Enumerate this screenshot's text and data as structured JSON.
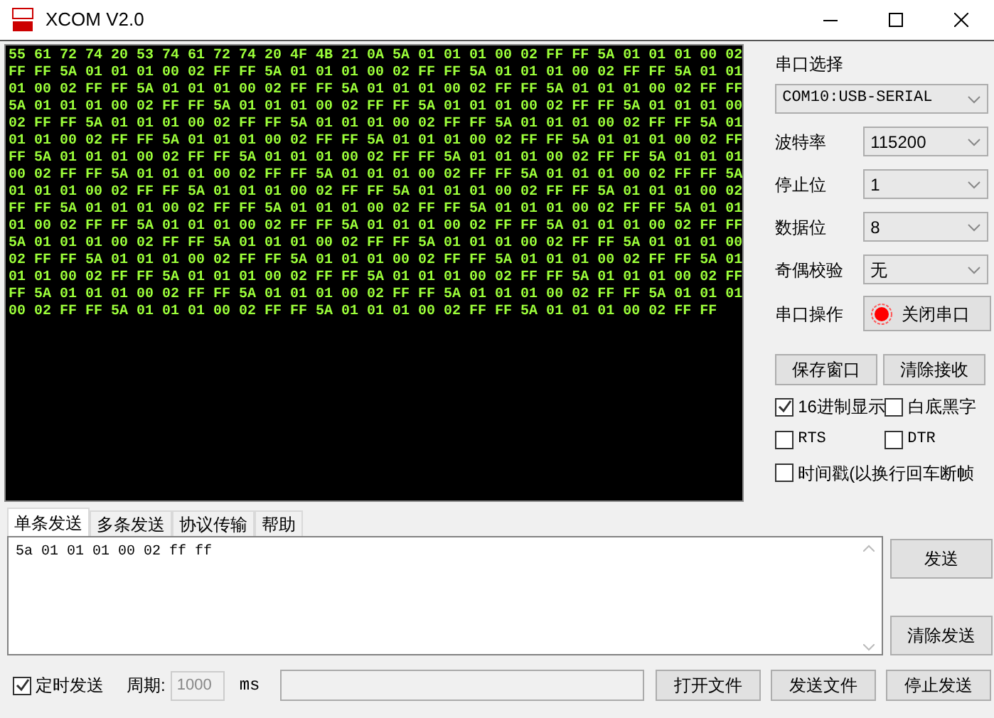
{
  "window": {
    "title": "XCOM V2.0"
  },
  "receive_lines": [
    "55 61 72 74 20 53 74 61 72 74 20 4F 4B 21 0A 5A 01 01 01 00 02 FF FF 5A 01 01 01 00 02",
    "FF FF 5A 01 01 01 00 02 FF FF 5A 01 01 01 00 02 FF FF 5A 01 01 01 00 02 FF FF 5A 01 01",
    "01 00 02 FF FF 5A 01 01 01 00 02 FF FF 5A 01 01 01 00 02 FF FF 5A 01 01 01 00 02 FF FF",
    "5A 01 01 01 00 02 FF FF 5A 01 01 01 00 02 FF FF 5A 01 01 01 00 02 FF FF 5A 01 01 01 00",
    "02 FF FF 5A 01 01 01 00 02 FF FF 5A 01 01 01 00 02 FF FF 5A 01 01 01 00 02 FF FF 5A 01",
    "01 01 00 02 FF FF 5A 01 01 01 00 02 FF FF 5A 01 01 01 00 02 FF FF 5A 01 01 01 00 02 FF",
    "FF 5A 01 01 01 00 02 FF FF 5A 01 01 01 00 02 FF FF 5A 01 01 01 00 02 FF FF 5A 01 01 01",
    "00 02 FF FF 5A 01 01 01 00 02 FF FF 5A 01 01 01 00 02 FF FF 5A 01 01 01 00 02 FF FF 5A",
    "01 01 01 00 02 FF FF 5A 01 01 01 00 02 FF FF 5A 01 01 01 00 02 FF FF 5A 01 01 01 00 02",
    "FF FF 5A 01 01 01 00 02 FF FF 5A 01 01 01 00 02 FF FF 5A 01 01 01 00 02 FF FF 5A 01 01",
    "01 00 02 FF FF 5A 01 01 01 00 02 FF FF 5A 01 01 01 00 02 FF FF 5A 01 01 01 00 02 FF FF",
    "5A 01 01 01 00 02 FF FF 5A 01 01 01 00 02 FF FF 5A 01 01 01 00 02 FF FF 5A 01 01 01 00",
    "02 FF FF 5A 01 01 01 00 02 FF FF 5A 01 01 01 00 02 FF FF 5A 01 01 01 00 02 FF FF 5A 01",
    "01 01 00 02 FF FF 5A 01 01 01 00 02 FF FF 5A 01 01 01 00 02 FF FF 5A 01 01 01 00 02 FF",
    "FF 5A 01 01 01 00 02 FF FF 5A 01 01 01 00 02 FF FF 5A 01 01 01 00 02 FF FF 5A 01 01 01",
    "00 02 FF FF 5A 01 01 01 00 02 FF FF 5A 01 01 01 00 02 FF FF 5A 01 01 01 00 02 FF FF"
  ],
  "settings": {
    "port_label": "串口选择",
    "port_value": "COM10:USB-SERIAL",
    "fields": [
      {
        "label": "波特率",
        "value": "115200"
      },
      {
        "label": "停止位",
        "value": "1"
      },
      {
        "label": "数据位",
        "value": "8"
      },
      {
        "label": "奇偶校验",
        "value": "无"
      }
    ],
    "operation_label": "串口操作",
    "operation_button": {
      "label": "关闭串口",
      "on": true
    },
    "buttons": [
      "保存窗口",
      "清除接收"
    ],
    "options": [
      {
        "label": "16进制显示",
        "checked": true
      },
      {
        "label": "白底黑字",
        "checked": false
      },
      {
        "label": "RTS",
        "checked": false
      },
      {
        "label": "DTR",
        "checked": false
      },
      {
        "label": "时间戳(以换行回车断帧",
        "checked": false
      }
    ]
  },
  "tabs": [
    {
      "label": "单条发送",
      "selected": true
    },
    {
      "label": "多条发送",
      "selected": false
    },
    {
      "label": "协议传输",
      "selected": false
    },
    {
      "label": "帮助",
      "selected": false
    }
  ],
  "send_text": "5a 01 01 01 00 02 ff ff",
  "send_buttons": [
    "发送",
    "清除发送"
  ],
  "bottom": {
    "timed": {
      "label": "定时发送",
      "checked": true
    },
    "period_label": "周期:",
    "period_value": "1000",
    "unit": "ms",
    "buttons": [
      "打开文件",
      "发送文件",
      "停止发送"
    ]
  }
}
